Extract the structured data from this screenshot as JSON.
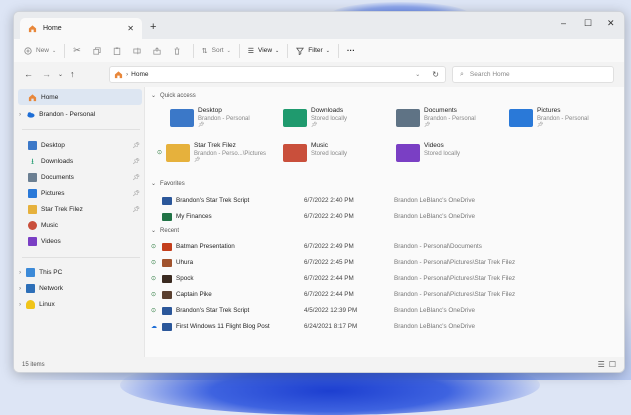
{
  "window": {
    "tab_title": "Home",
    "new_tab": "+",
    "minimize": "–",
    "maximize": "☐",
    "close": "✕",
    "tab_close": "✕"
  },
  "toolbar": {
    "new_label": "New",
    "sort_label": "Sort",
    "view_label": "View",
    "filter_label": "Filter",
    "more_label": "···"
  },
  "address": {
    "path": "Home",
    "search_placeholder": "Search Home"
  },
  "sidebar": {
    "top": [
      {
        "label": "Home",
        "icon": "home-icon"
      },
      {
        "label": "Brandon - Personal",
        "icon": "onedrive-icon"
      }
    ],
    "pinned": [
      {
        "label": "Desktop",
        "icon": "desktop-icon"
      },
      {
        "label": "Downloads",
        "icon": "downloads-icon"
      },
      {
        "label": "Documents",
        "icon": "documents-icon"
      },
      {
        "label": "Pictures",
        "icon": "pictures-icon"
      },
      {
        "label": "Star Trek Filez",
        "icon": "folder-icon"
      },
      {
        "label": "Music",
        "icon": "music-icon"
      },
      {
        "label": "Videos",
        "icon": "videos-icon"
      }
    ],
    "bottom": [
      {
        "label": "This PC",
        "icon": "pc-icon"
      },
      {
        "label": "Network",
        "icon": "network-icon"
      },
      {
        "label": "Linux",
        "icon": "linux-icon"
      }
    ]
  },
  "quick_access": {
    "header": "Quick access",
    "items": [
      {
        "name": "Desktop",
        "sub": "Brandon - Personal",
        "color": "#3b78c8"
      },
      {
        "name": "Downloads",
        "sub": "Stored locally",
        "color": "#1f9a6e"
      },
      {
        "name": "Documents",
        "sub": "Brandon - Personal",
        "color": "#5f7385"
      },
      {
        "name": "Pictures",
        "sub": "Brandon - Personal",
        "color": "#2a79d8"
      },
      {
        "name": "Star Trek Filez",
        "sub": "Brandon - Perso...\\Pictures",
        "color": "#e6b13c"
      },
      {
        "name": "Music",
        "sub": "Stored locally",
        "color": "#c94f3b"
      },
      {
        "name": "Videos",
        "sub": "Stored locally",
        "color": "#7a3fc4"
      }
    ]
  },
  "favorites": {
    "header": "Favorites",
    "rows": [
      {
        "name": "Brandon's Star Trek Script",
        "date": "6/7/2022 2:40 PM",
        "loc": "Brandon LeBlanc's OneDrive"
      },
      {
        "name": "My Finances",
        "date": "6/7/2022 2:40 PM",
        "loc": "Brandon LeBlanc's OneDrive"
      }
    ]
  },
  "recent": {
    "header": "Recent",
    "rows": [
      {
        "name": "Batman Presentation",
        "date": "6/7/2022 2:49 PM",
        "loc": "Brandon - Personal\\Documents"
      },
      {
        "name": "Uhura",
        "date": "6/7/2022 2:45 PM",
        "loc": "Brandon - Personal\\Pictures\\Star Trek Filez"
      },
      {
        "name": "Spock",
        "date": "6/7/2022 2:44 PM",
        "loc": "Brandon - Personal\\Pictures\\Star Trek Filez"
      },
      {
        "name": "Captain Pike",
        "date": "6/7/2022 2:44 PM",
        "loc": "Brandon - Personal\\Pictures\\Star Trek Filez"
      },
      {
        "name": "Brandon's Star Trek Script",
        "date": "4/5/2022 12:39 PM",
        "loc": "Brandon LeBlanc's OneDrive"
      },
      {
        "name": "First Windows 11 Flight Blog Post",
        "date": "6/24/2021 8:17 PM",
        "loc": "Brandon LeBlanc's OneDrive"
      }
    ]
  },
  "status": {
    "count": "15 items"
  }
}
